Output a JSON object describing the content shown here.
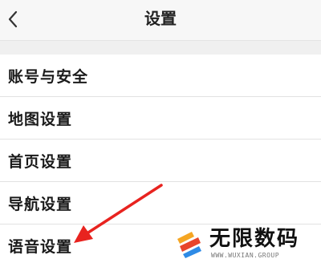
{
  "header": {
    "title": "设置",
    "back_icon": "chevron-left-icon"
  },
  "settings": {
    "items": [
      {
        "label": "账号与安全"
      },
      {
        "label": "地图设置"
      },
      {
        "label": "首页设置"
      },
      {
        "label": "导航设置"
      },
      {
        "label": "语音设置"
      }
    ]
  },
  "annotation": {
    "arrow_color": "#e8231f",
    "target": "语音设置"
  },
  "watermark": {
    "title": "无限数码",
    "subtitle": "WWW.WUXIAN.GROUP"
  }
}
